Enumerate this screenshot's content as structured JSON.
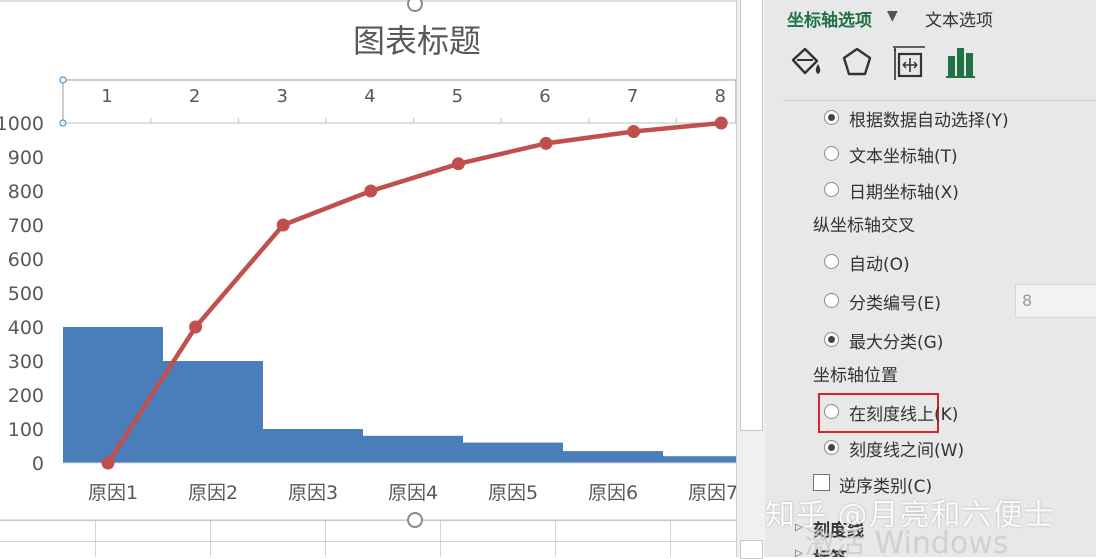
{
  "chart_data": {
    "type": "bar+line",
    "title": "图表标题",
    "categories": [
      "原因1",
      "原因2",
      "原因3",
      "原因4",
      "原因5",
      "原因6",
      "原因7"
    ],
    "bar_values": [
      400,
      300,
      100,
      80,
      60,
      35,
      20
    ],
    "line_x": [
      1,
      2,
      3,
      4,
      5,
      6,
      7,
      8
    ],
    "line_values": [
      0,
      400,
      700,
      800,
      880,
      940,
      975,
      1000
    ],
    "secondary_x_ticks": [
      "1",
      "2",
      "3",
      "4",
      "5",
      "6",
      "7",
      "8"
    ],
    "y_ticks": [
      "0",
      "100",
      "200",
      "300",
      "400",
      "500",
      "600",
      "700",
      "800",
      "900",
      "1000"
    ],
    "ylim": [
      0,
      1000
    ],
    "bar_color": "#4a7ebb",
    "line_color": "#c0504d"
  },
  "pane": {
    "tab_axis": "坐标轴选项",
    "tab_text": "文本选项",
    "icons": [
      "fill-bucket-icon",
      "pentagon-icon",
      "size-properties-icon",
      "bar-chart-icon"
    ],
    "options": {
      "auto_select": "根据数据自动选择(Y)",
      "text_axis": "文本坐标轴(T)",
      "date_axis": "日期坐标轴(X)",
      "cross_title": "纵坐标轴交叉",
      "cross_auto": "自动(O)",
      "cross_category": "分类编号(E)",
      "cross_category_value": "8",
      "cross_max": "最大分类(G)",
      "pos_title": "坐标轴位置",
      "pos_on_tick": "在刻度线上(K)",
      "pos_between": "刻度线之间(W)",
      "reverse": "逆序类别(C)",
      "tick_marks": "刻度线",
      "labels": "标签"
    },
    "accent_color": "#217346"
  },
  "watermark": {
    "zhihu": "知乎 @月亮和六便士",
    "activate": "激活 Windows"
  }
}
